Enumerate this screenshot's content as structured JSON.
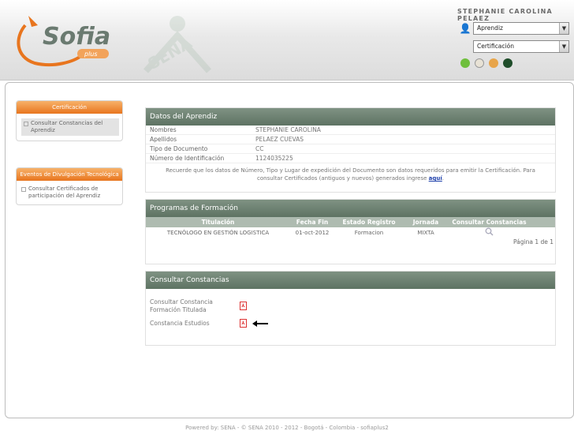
{
  "brand": {
    "logo_text": "Sofia",
    "logo_sub": "plus",
    "accent": "#e8751e",
    "green": "#6a9a3c"
  },
  "user": {
    "name": "STEPHANIE CAROLINA PELAEZ",
    "role_select": "Aprendiz",
    "module_select": "Certificación",
    "icons": [
      "help-icon",
      "mail-icon",
      "star-icon",
      "power-icon"
    ]
  },
  "sidebar": {
    "box1": {
      "title": "Certificación",
      "items": [
        "Consultar Constancias del Aprendiz"
      ]
    },
    "box2": {
      "title": "Eventos de Divulgación Tecnológica",
      "items": [
        "Consultar Certificados de participación del Aprendiz"
      ]
    }
  },
  "aprendiz": {
    "title": "Datos del Aprendiz",
    "rows": [
      {
        "k": "Nombres",
        "v": "STEPHANIE CAROLINA"
      },
      {
        "k": "Apellidos",
        "v": "PELAEZ CUEVAS"
      },
      {
        "k": "Tipo de Documento",
        "v": "CC"
      },
      {
        "k": "Número de Identificación",
        "v": "1124035225"
      }
    ],
    "note": "Recuerde que los datos de Número, Tipo y Lugar de expedición del Documento son datos requeridos para emitir la Certificación. Para consultar Certificados (antiguos y nuevos) generados ingrese",
    "note_link": "aquí"
  },
  "programas": {
    "title": "Programas de Formación",
    "headers": [
      "Titulación",
      "Fecha Fin",
      "Estado Registro",
      "Jornada",
      "Consultar Constancias"
    ],
    "rows": [
      [
        "TECNÓLOGO EN GESTIÓN LOGISTICA",
        "01-oct-2012",
        "Formacion",
        "MIXTA"
      ]
    ],
    "pager": "Página 1 de 1"
  },
  "constancias": {
    "title": "Consultar Constancias",
    "items": [
      "Consultar Constancia Formación Titulada",
      "Constancia Estudios"
    ]
  },
  "footer": "Powered by: SENA - © SENA 2010 - 2012 - Bogotá - Colombia - sofiaplus2"
}
